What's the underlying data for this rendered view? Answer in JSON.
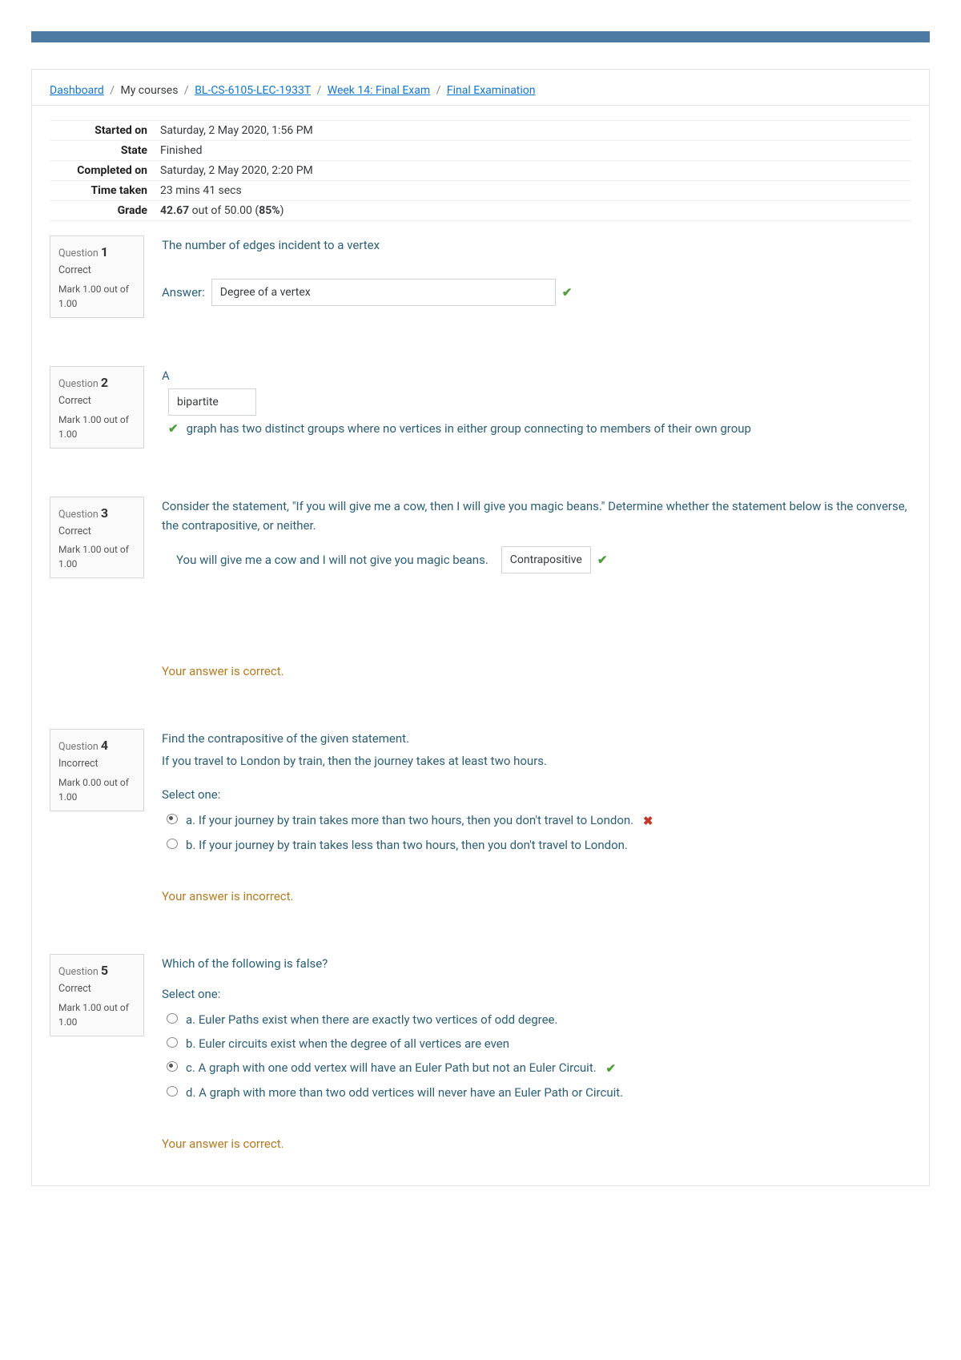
{
  "breadcrumb": {
    "dashboard": "Dashboard",
    "mycourses": "My courses",
    "course": "BL-CS-6105-LEC-1933T",
    "week": "Week 14: Final Exam",
    "exam": "Final Examination"
  },
  "summary": {
    "started_label": "Started on",
    "started_value": "Saturday, 2 May 2020, 1:56 PM",
    "state_label": "State",
    "state_value": "Finished",
    "completed_label": "Completed on",
    "completed_value": "Saturday, 2 May 2020, 2:20 PM",
    "time_label": "Time taken",
    "time_value": "23 mins 41 secs",
    "grade_label": "Grade",
    "grade_bold": "42.67",
    "grade_rest": " out of 50.00 (",
    "grade_pct": "85%",
    "grade_close": ")"
  },
  "q1": {
    "qlbl": "Question ",
    "qnum": "1",
    "state": "Correct",
    "mark": "Mark 1.00 out of 1.00",
    "text": "The number of edges incident to a vertex",
    "answer_label": "Answer:",
    "answer_value": "Degree of a vertex"
  },
  "q2": {
    "qlbl": "Question ",
    "qnum": "2",
    "state": "Correct",
    "mark": "Mark 1.00 out of 1.00",
    "pre": "A",
    "answer_value": "bipartite",
    "post": "graph has two distinct groups where no vertices in either group connecting to members of their own group"
  },
  "q3": {
    "qlbl": "Question ",
    "qnum": "3",
    "state": "Correct",
    "mark": "Mark 1.00 out of 1.00",
    "text": "Consider the statement, \"If you will give me a cow, then I will give you magic beans.\" Determine whether the statement below is the converse, the contrapositive, or neither.",
    "bullet": "You will give me a cow and I will not give you magic beans.",
    "select_value": "Contrapositive",
    "feedback": "Your answer is correct."
  },
  "q4": {
    "qlbl": "Question ",
    "qnum": "4",
    "state": "Incorrect",
    "mark": "Mark 0.00 out of 1.00",
    "text1": "Find the contrapositive of the given statement.",
    "text2": "If you travel to London by train, then the journey takes at least two hours.",
    "select_label": "Select one:",
    "opt_a": "a. If your journey by train takes more than two hours, then you don't travel to London.",
    "opt_b": "b. If your journey by train takes less than two hours, then you don't travel to London.",
    "feedback": "Your answer is incorrect."
  },
  "q5": {
    "qlbl": "Question ",
    "qnum": "5",
    "state": "Correct",
    "mark": "Mark 1.00 out of 1.00",
    "text": "Which of the following is false?",
    "select_label": "Select one:",
    "opt_a": "a. Euler Paths exist when there are exactly two vertices of odd degree.",
    "opt_b": "b. Euler circuits exist when the degree of all vertices are even",
    "opt_c": "c. A graph with one odd vertex will have an Euler Path but not an Euler Circuit.",
    "opt_d": "d. A graph with more than two odd vertices will never have an Euler Path or Circuit.",
    "feedback": "Your answer is correct."
  }
}
